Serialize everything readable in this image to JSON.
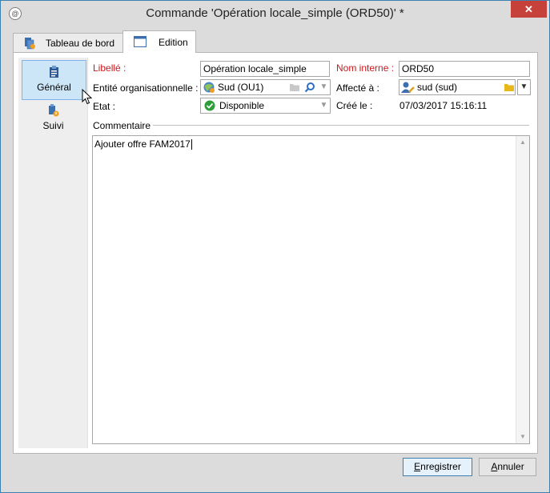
{
  "window": {
    "title": "Commande 'Opération locale_simple  (ORD50)' *",
    "close_symbol": "✕"
  },
  "tabs": [
    {
      "label": "Tableau de bord",
      "icon": "dashboard-icon"
    },
    {
      "label": "Edition",
      "icon": "window-icon",
      "active": true
    }
  ],
  "sidenav": {
    "items": [
      {
        "label": "Général",
        "icon": "clipboard-icon",
        "selected": true
      },
      {
        "label": "Suivi",
        "icon": "tracking-icon",
        "selected": false
      }
    ]
  },
  "form": {
    "libelle_label": "Libellé :",
    "libelle_value": "Opération locale_simple",
    "nom_interne_label": "Nom interne :",
    "nom_interne_value": "ORD50",
    "entite_label": "Entité organisationnelle :",
    "entite_value": "Sud (OU1)",
    "affecte_label": "Affecté à :",
    "affecte_value": "sud (sud)",
    "etat_label": "Etat :",
    "etat_value": "Disponible",
    "cree_label": "Créé le :",
    "cree_value": "07/03/2017 15:16:11",
    "commentaire_label": "Commentaire",
    "commentaire_value": "Ajouter offre FAM2017"
  },
  "footer": {
    "save_first": "E",
    "save_rest": "nregistrer",
    "cancel_first": "A",
    "cancel_rest": "nnuler"
  },
  "colors": {
    "required_label": "#c8191e",
    "selection": "#cde6f7",
    "status_ok": "#2e9e3a",
    "close_button": "#c7413b"
  }
}
